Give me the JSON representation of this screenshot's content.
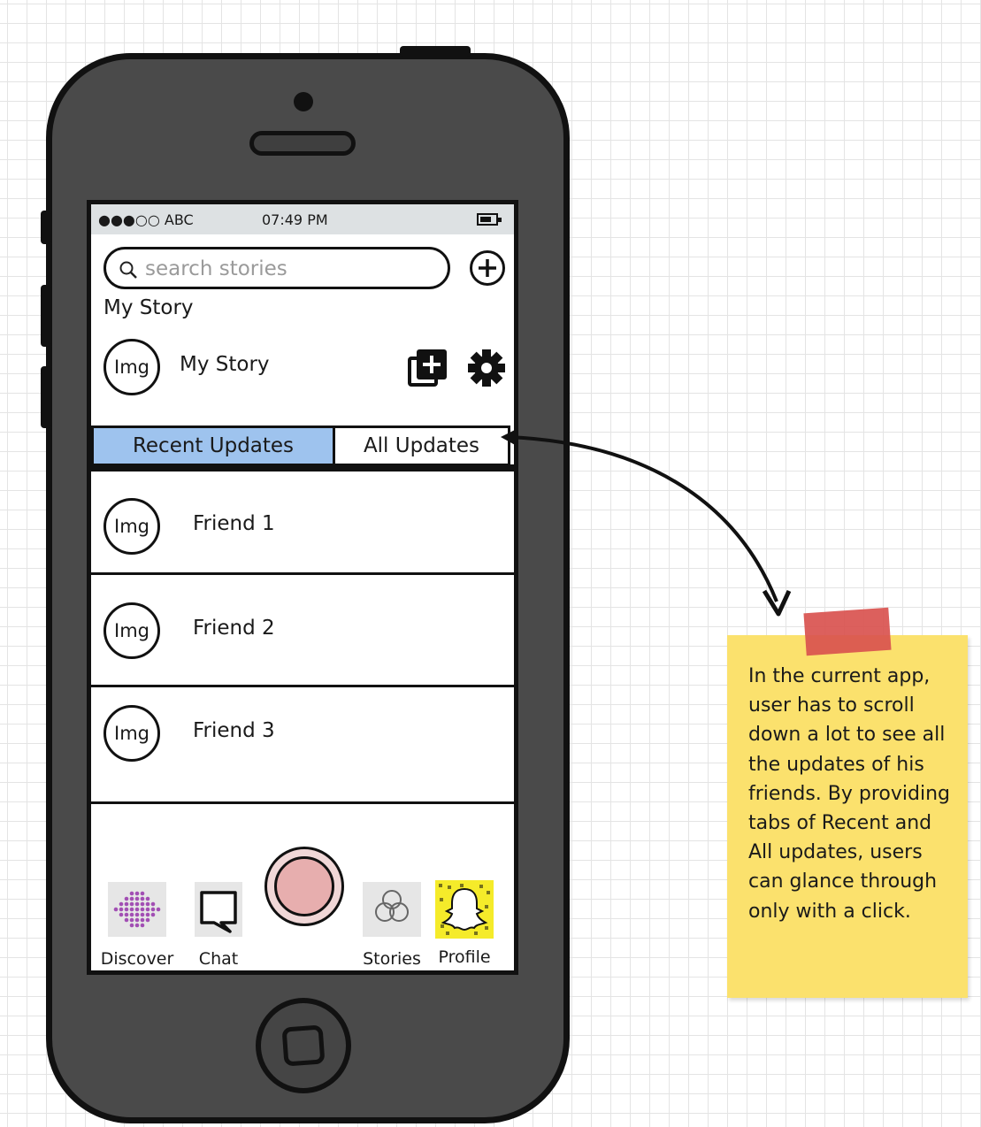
{
  "status_bar": {
    "carrier": "●●●○○ ABC",
    "time": "07:49 PM"
  },
  "search": {
    "placeholder": "search stories"
  },
  "my_story": {
    "section_title": "My Story",
    "avatar_label": "Img",
    "name": "My Story"
  },
  "tabs": [
    {
      "label": "Recent Updates",
      "active": true
    },
    {
      "label": "All Updates",
      "active": false
    }
  ],
  "friends": [
    {
      "avatar_label": "Img",
      "name": "Friend 1"
    },
    {
      "avatar_label": "Img",
      "name": "Friend 2"
    },
    {
      "avatar_label": "Img",
      "name": "Friend 3"
    }
  ],
  "bottom_nav": [
    {
      "label": "Discover",
      "icon": "discover-icon"
    },
    {
      "label": "Chat",
      "icon": "chat-icon"
    },
    {
      "label": "Stories",
      "icon": "stories-icon"
    },
    {
      "label": "Profile",
      "icon": "snapchat-ghost-icon"
    }
  ],
  "note": {
    "text": "In the current app, user has to scroll down a lot to see all the updates of his friends. By providing tabs of Recent and All updates, users can glance through only with a click."
  },
  "colors": {
    "active_tab": "#9ec3ee",
    "note_background": "#fbe16d",
    "note_tape": "#d9534f",
    "capture_button": "#e7aeae",
    "profile_tile": "#f5eb2a",
    "discover_dots": "#a24fb4"
  }
}
